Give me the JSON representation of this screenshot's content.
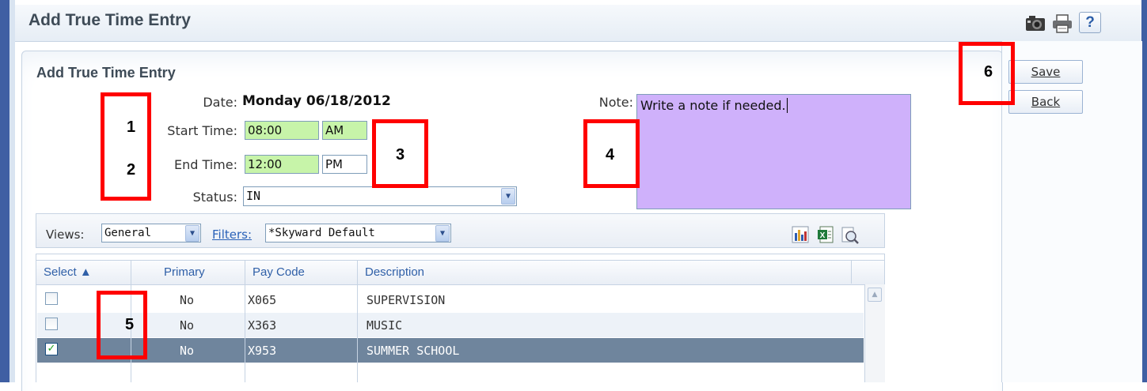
{
  "header": {
    "title": "Add True Time Entry",
    "help_label": "?"
  },
  "form": {
    "title": "Add True Time Entry",
    "date_label": "Date:",
    "date_value": "Monday 06/18/2012",
    "start_label": "Start Time:",
    "start_time": "08:00",
    "start_ampm": "AM",
    "end_label": "End Time:",
    "end_time": "12:00",
    "end_ampm": "PM",
    "status_label": "Status:",
    "status_value": "IN",
    "note_label": "Note:",
    "note_value": "Write a note if needed."
  },
  "actions": {
    "save": "Save",
    "back": "Back"
  },
  "toolbar": {
    "views_label": "Views:",
    "views_value": "General",
    "filters_label": "Filters:",
    "filters_value": "*Skyward Default"
  },
  "grid": {
    "columns": [
      "Select ▲",
      "Primary",
      "Pay Code",
      "Description"
    ],
    "rows": [
      {
        "selected": false,
        "primary": "No",
        "pay_code": "X065",
        "description": "SUPERVISION"
      },
      {
        "selected": false,
        "primary": "No",
        "pay_code": "X363",
        "description": "MUSIC"
      },
      {
        "selected": true,
        "primary": "No",
        "pay_code": "X953",
        "description": "SUMMER SCHOOL"
      }
    ]
  },
  "annotations": [
    "1",
    "2",
    "3",
    "4",
    "5",
    "6"
  ],
  "colors": {
    "accent": "#3f5fa3",
    "time_field": "#c7f4a9",
    "note_field": "#cfb1fb",
    "selected_row": "#6f859d",
    "annotation": "#ff0000"
  }
}
